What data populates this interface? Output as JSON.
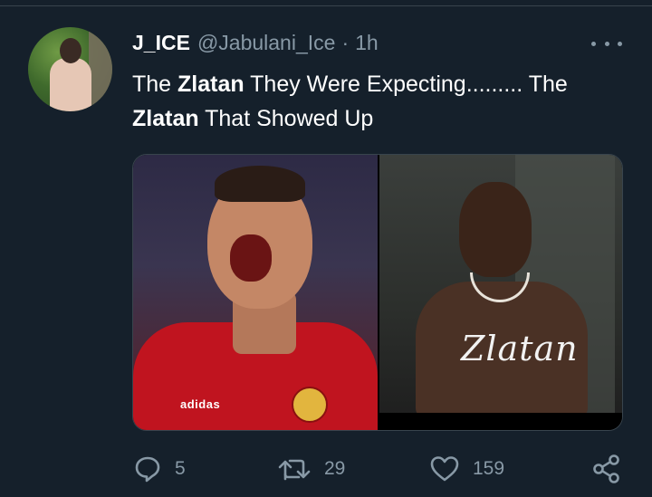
{
  "tweet": {
    "display_name": "J_ICE",
    "handle": "@Jabulani_Ice",
    "separator": "·",
    "time": "1h",
    "text": {
      "part1": "The ",
      "bold1": "Zlatan",
      "part2": " They Were Expecting......... The ",
      "bold2": "Zlatan",
      "part3": " That Showed Up"
    },
    "media": {
      "left_image_brand_text": "adidas",
      "right_image_overlay_text": "Zlatan"
    }
  },
  "actions": {
    "replies": "5",
    "retweets": "29",
    "likes": "159"
  },
  "icons": {
    "reply": "reply-icon",
    "retweet": "retweet-icon",
    "like": "heart-icon",
    "share": "share-icon",
    "more": "more-options-icon"
  },
  "colors": {
    "background": "#15202b",
    "text": "#ffffff",
    "muted": "#8899a6",
    "border": "#38444d"
  }
}
